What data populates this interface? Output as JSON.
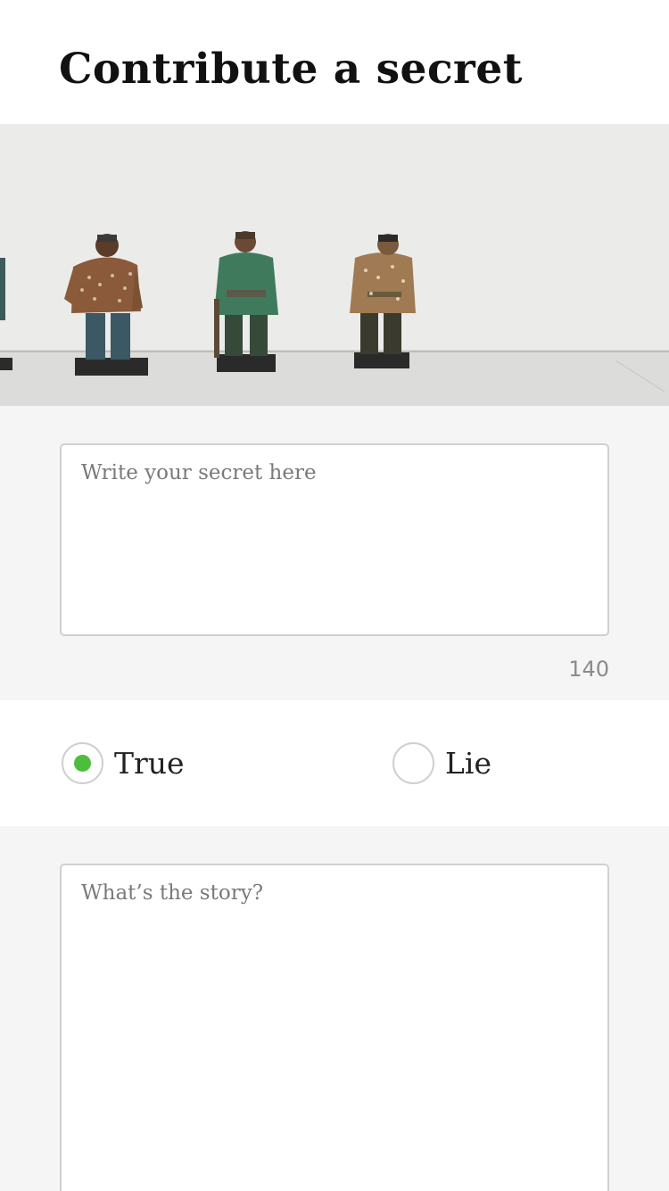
{
  "header": {
    "title": "Contribute a secret"
  },
  "hero": {
    "description": "Photo of painted figurine sculptures standing in a row against a white gallery wall"
  },
  "secret_input": {
    "placeholder": "Write your secret here",
    "value": ""
  },
  "char_counter": "140",
  "truth_choice": {
    "options": [
      {
        "label": "True",
        "selected": true
      },
      {
        "label": "Lie",
        "selected": false
      }
    ],
    "accent_color": "#4dbd3d"
  },
  "story_input": {
    "placeholder": "What’s the story?",
    "value": ""
  }
}
